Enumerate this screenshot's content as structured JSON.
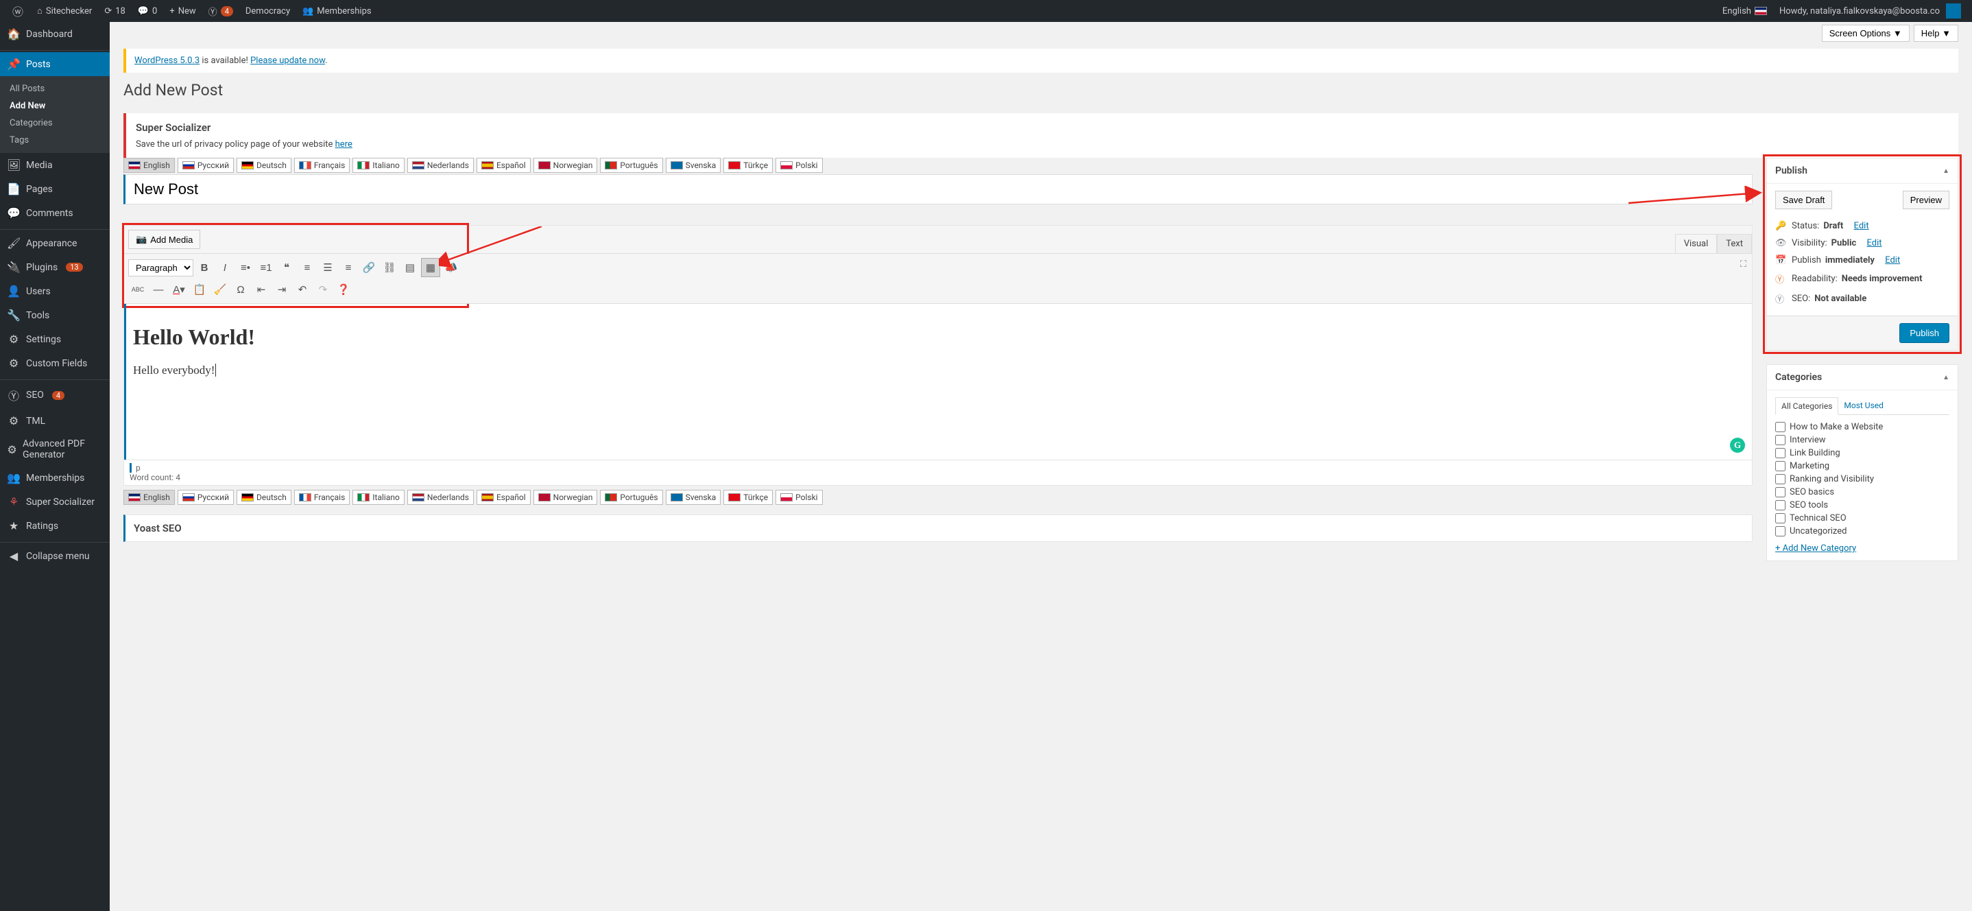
{
  "adminbar": {
    "site": "Sitechecker",
    "updates": "18",
    "comments": "0",
    "new": "New",
    "yoast_count": "4",
    "democracy": "Democracy",
    "memberships": "Memberships",
    "lang": "English",
    "howdy": "Howdy, nataliya.fialkovskaya@boosta.co"
  },
  "menu": {
    "dashboard": "Dashboard",
    "posts": "Posts",
    "posts_sub": {
      "all": "All Posts",
      "add": "Add New",
      "cats": "Categories",
      "tags": "Tags"
    },
    "media": "Media",
    "pages": "Pages",
    "comments": "Comments",
    "appearance": "Appearance",
    "plugins": "Plugins",
    "plugins_count": "13",
    "users": "Users",
    "tools": "Tools",
    "settings": "Settings",
    "custom_fields": "Custom Fields",
    "seo": "SEO",
    "seo_count": "4",
    "tml": "TML",
    "apdf": "Advanced PDF Generator",
    "memberships": "Memberships",
    "supersoc": "Super Socializer",
    "ratings": "Ratings",
    "collapse": "Collapse menu"
  },
  "screen": {
    "options": "Screen Options ▼",
    "help": "Help ▼"
  },
  "notice_update": {
    "pre": "WordPress 5.0.3",
    "mid": " is available! ",
    "link": "Please update now",
    "suf": "."
  },
  "page_title": "Add New Post",
  "notice_ss": {
    "title": "Super Socializer",
    "text": "Save the url of privacy policy page of your website ",
    "link": "here"
  },
  "langs": [
    {
      "code": "en",
      "label": "English"
    },
    {
      "code": "ru",
      "label": "Русский"
    },
    {
      "code": "de",
      "label": "Deutsch"
    },
    {
      "code": "fr",
      "label": "Français"
    },
    {
      "code": "it",
      "label": "Italiano"
    },
    {
      "code": "nl",
      "label": "Nederlands"
    },
    {
      "code": "es",
      "label": "Español"
    },
    {
      "code": "no",
      "label": "Norwegian"
    },
    {
      "code": "pt",
      "label": "Português"
    },
    {
      "code": "sv",
      "label": "Svenska"
    },
    {
      "code": "tr",
      "label": "Türkçe"
    },
    {
      "code": "pl",
      "label": "Polski"
    }
  ],
  "post_title": "New Post",
  "editor": {
    "add_media": "Add Media",
    "visual": "Visual",
    "text": "Text",
    "para": "Paragraph",
    "heading": "Hello World!",
    "body": "Hello everybody!",
    "path": "p",
    "wc_label": "Word count: ",
    "wc": "4",
    "abc": "ABC"
  },
  "publish": {
    "title": "Publish",
    "save_draft": "Save Draft",
    "preview": "Preview",
    "status_lbl": "Status: ",
    "status_val": "Draft",
    "edit": "Edit",
    "vis_lbl": "Visibility: ",
    "vis_val": "Public",
    "pub_lbl": "Publish ",
    "pub_val": "immediately",
    "read_lbl": "Readability: ",
    "read_val": "Needs improvement",
    "seo_lbl": "SEO: ",
    "seo_val": "Not available",
    "publish_btn": "Publish"
  },
  "categories": {
    "title": "Categories",
    "tab_all": "All Categories",
    "tab_most": "Most Used",
    "items": [
      "How to Make a Website",
      "Interview",
      "Link Building",
      "Marketing",
      "Ranking and Visibility",
      "SEO basics",
      "SEO tools",
      "Technical SEO",
      "Uncategorized"
    ],
    "add_new": "+ Add New Category"
  },
  "yoast": "Yoast SEO"
}
